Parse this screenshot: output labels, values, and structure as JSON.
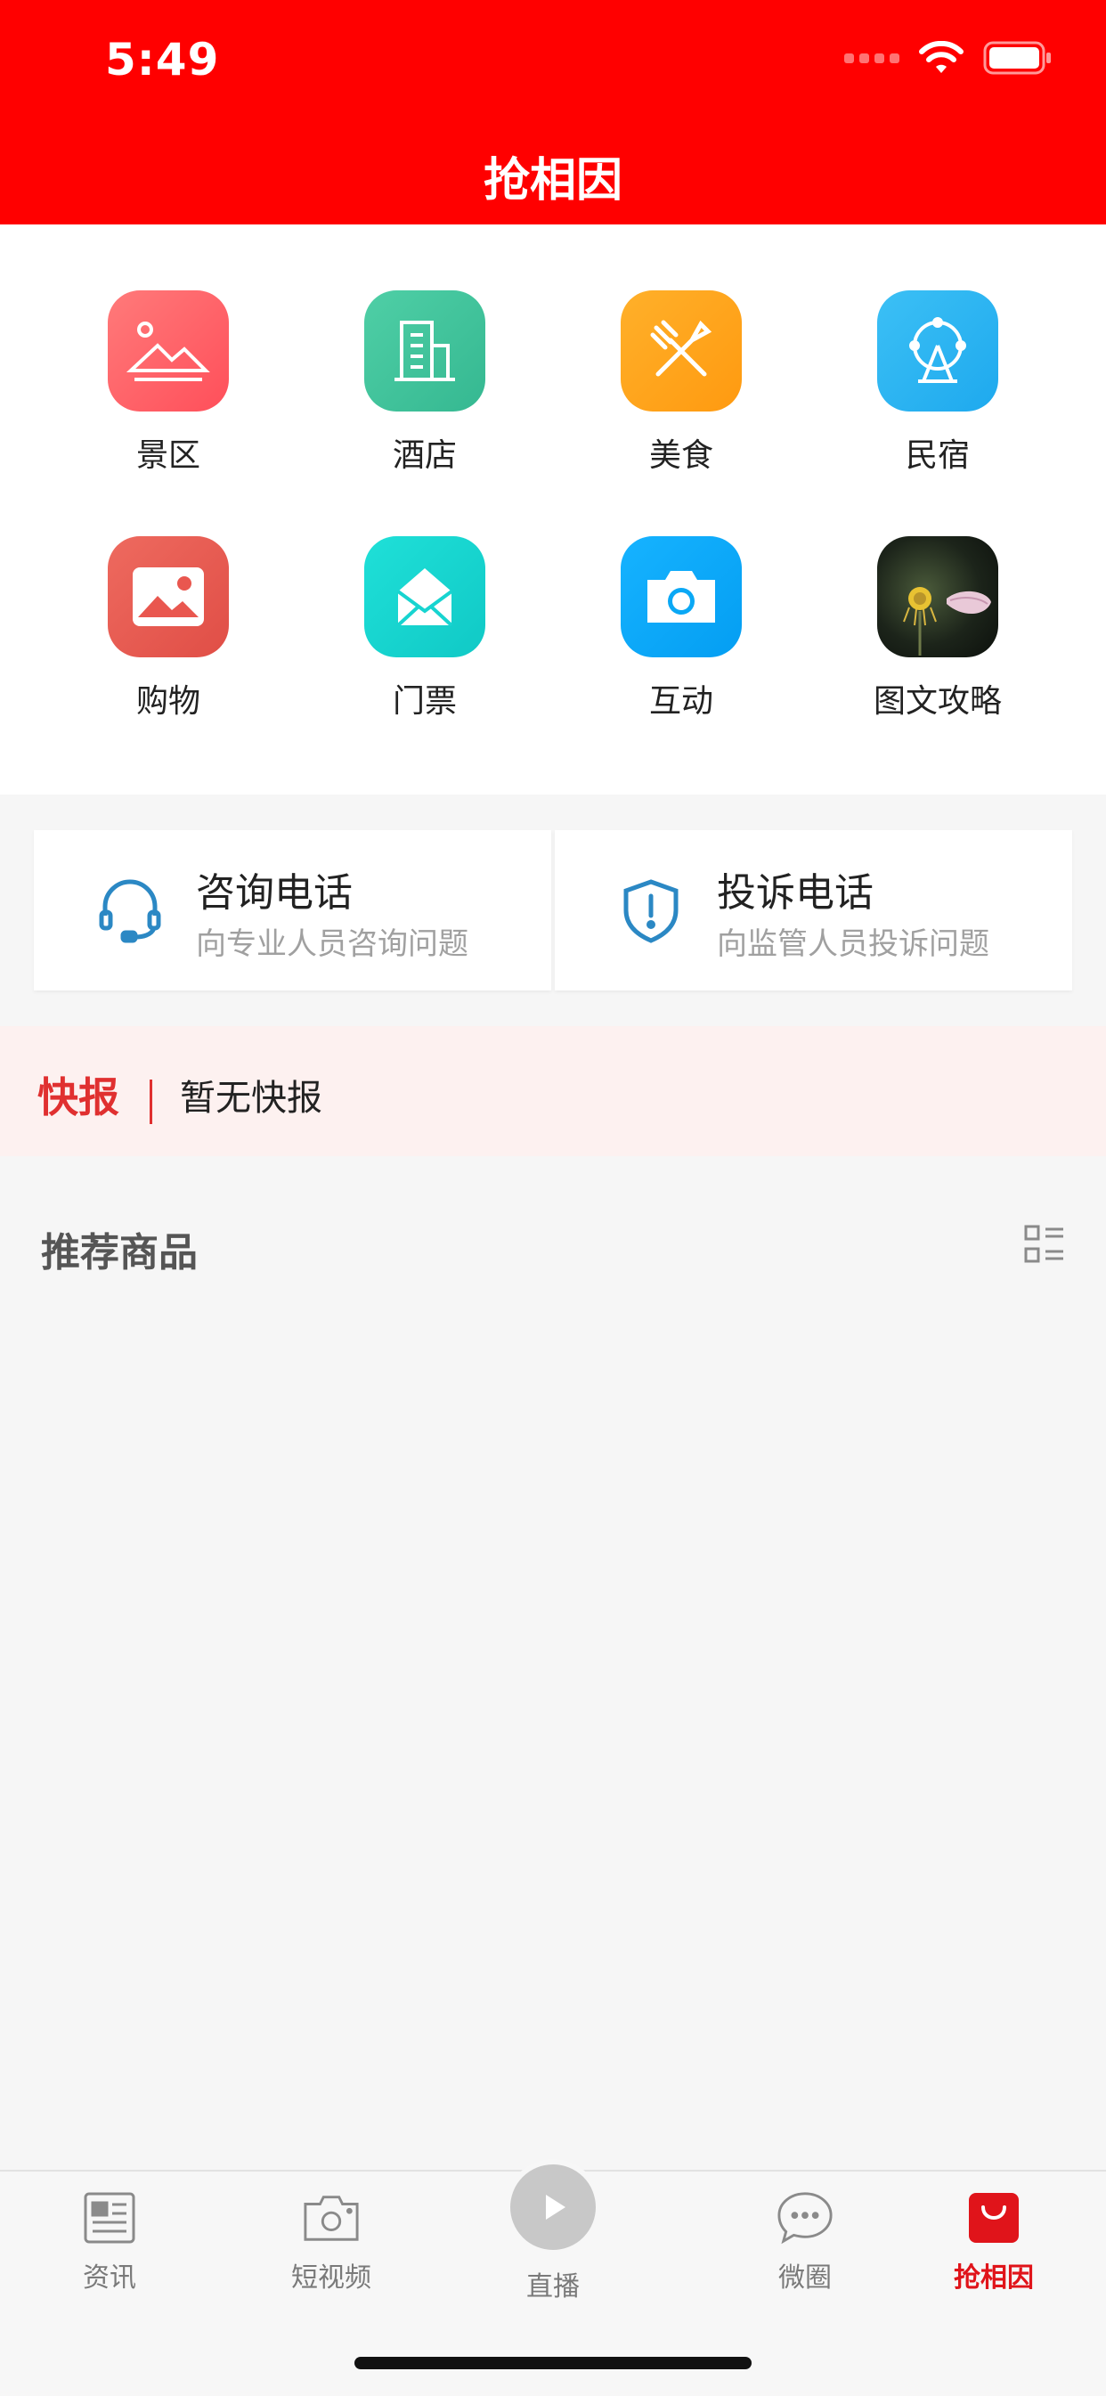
{
  "status_bar": {
    "time": "5:49"
  },
  "header": {
    "title": "抢相因"
  },
  "categories": [
    {
      "label": "景区",
      "icon": "landscape-icon",
      "color": "#ff5a5f"
    },
    {
      "label": "酒店",
      "icon": "building-icon",
      "color": "#3dbf9a"
    },
    {
      "label": "美食",
      "icon": "utensils-icon",
      "color": "#ffa31a"
    },
    {
      "label": "民宿",
      "icon": "ferris-wheel-icon",
      "color": "#29b6f6"
    },
    {
      "label": "购物",
      "icon": "image-icon",
      "color": "#e9574f"
    },
    {
      "label": "门票",
      "icon": "envelope-icon",
      "color": "#17d4d0"
    },
    {
      "label": "互动",
      "icon": "camera-icon",
      "color": "#0aa8f5"
    },
    {
      "label": "图文攻略",
      "icon": "lotus-photo-icon",
      "color": "#1f2a1f"
    }
  ],
  "contacts": [
    {
      "title": "咨询电话",
      "subtitle": "向专业人员咨询问题",
      "icon": "headset-icon"
    },
    {
      "title": "投诉电话",
      "subtitle": "向监管人员投诉问题",
      "icon": "shield-alert-icon"
    }
  ],
  "news": {
    "label": "快报",
    "text": "暂无快报"
  },
  "recommend": {
    "title": "推荐商品"
  },
  "tabbar": {
    "items": [
      {
        "label": "资讯",
        "icon": "newspaper-icon"
      },
      {
        "label": "短视频",
        "icon": "camera-icon"
      },
      {
        "label": "直播",
        "icon": "play-icon"
      },
      {
        "label": "微圈",
        "icon": "chat-bubble-icon"
      },
      {
        "label": "抢相因",
        "icon": "shopping-bag-icon"
      }
    ],
    "active_color": "#e0141a"
  },
  "colors": {
    "brand": "#ff0000",
    "accent": "#e03030"
  }
}
